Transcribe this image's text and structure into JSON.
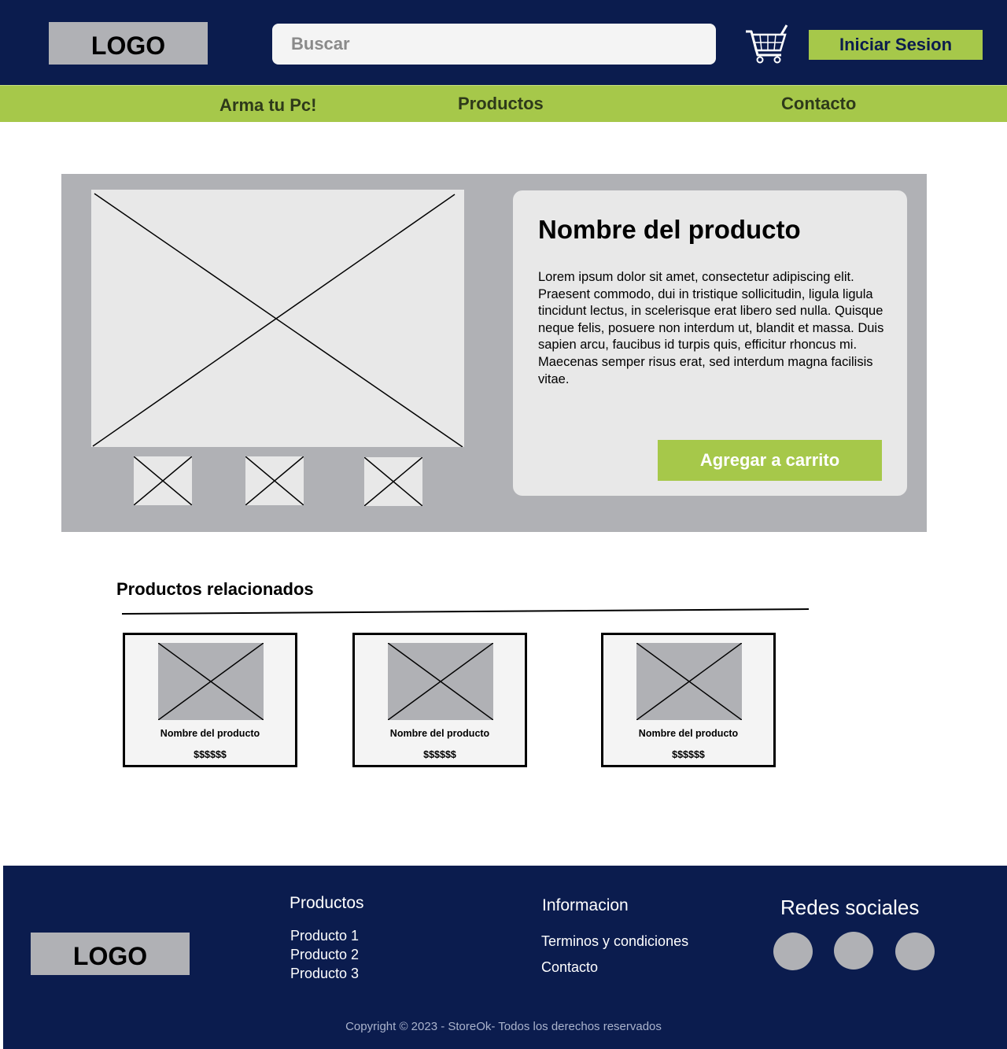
{
  "header": {
    "logo": "LOGO",
    "search_placeholder": "Buscar",
    "login_label": "Iniciar Sesion"
  },
  "nav": {
    "items": [
      {
        "label": "Arma tu Pc!"
      },
      {
        "label": "Productos"
      },
      {
        "label": "Contacto"
      }
    ]
  },
  "product": {
    "name": "Nombre del producto",
    "description": "Lorem ipsum dolor sit amet, consectetur adipiscing elit. Praesent commodo, dui in tristique sollicitudin, ligula ligula tincidunt lectus, in scelerisque erat libero sed nulla. Quisque neque felis, posuere non interdum ut, blandit et massa. Duis sapien arcu, faucibus id turpis quis, efficitur rhoncus mi. Maecenas semper risus erat, sed interdum magna facilisis vitae.",
    "add_to_cart_label": "Agregar a carrito"
  },
  "related": {
    "title": "Productos relacionados",
    "items": [
      {
        "name": "Nombre del producto",
        "price": "$$$$$$"
      },
      {
        "name": "Nombre del producto",
        "price": "$$$$$$"
      },
      {
        "name": "Nombre del producto",
        "price": "$$$$$$"
      }
    ]
  },
  "footer": {
    "logo": "LOGO",
    "productos": {
      "title": "Productos",
      "links": [
        "Producto 1",
        "Producto 2",
        "Producto 3"
      ]
    },
    "informacion": {
      "title": "Informacion",
      "links": [
        "Terminos y condiciones",
        "Contacto"
      ]
    },
    "redes": {
      "title": "Redes sociales"
    },
    "copyright": "Copyright © 2023 - StoreOk- Todos los derechos reservados"
  },
  "colors": {
    "navy": "#0b1c4e",
    "accent_green": "#a6c84a",
    "placeholder_gray": "#b0b1b5",
    "card_light": "#e8e8e8"
  }
}
